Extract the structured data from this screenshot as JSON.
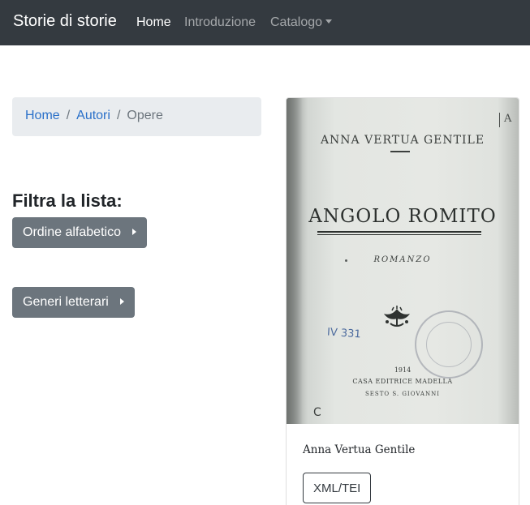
{
  "navbar": {
    "brand": "Storie di storie",
    "links": [
      {
        "label": "Home",
        "active": true
      },
      {
        "label": "Introduzione",
        "active": false
      },
      {
        "label": "Catalogo",
        "active": false,
        "dropdown": true
      }
    ],
    "background": "#343a40"
  },
  "breadcrumb": {
    "items": [
      "Home",
      "Autori",
      "Opere"
    ],
    "separator": "/"
  },
  "filters": {
    "title": "Filtra la lista:",
    "buttons": [
      "Ordine alfabetico",
      "Generi letterari"
    ],
    "button_color": "#6c757d"
  },
  "card": {
    "cover": {
      "author": "ANNA VERTUA GENTILE",
      "title": "ANGOLO ROMITO",
      "genre": "ROMANZO",
      "shelfmark": "IV 331",
      "year": "1914",
      "publisher": "CASA EDITRICE MADELLA",
      "place": "SESTO S. GIOVANNI",
      "corner_mark": "A"
    },
    "author": "Anna Vertua Gentile",
    "button": "XML/TEI"
  }
}
